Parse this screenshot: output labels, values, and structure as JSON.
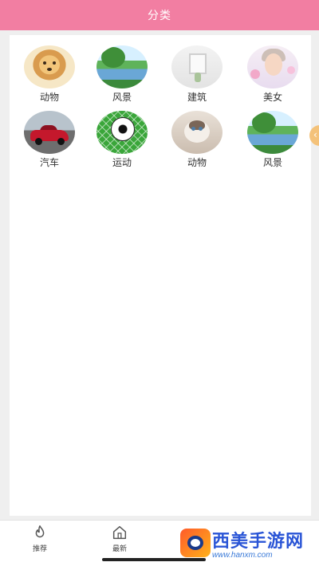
{
  "header": {
    "title": "分类"
  },
  "categories": [
    {
      "label": "动物",
      "image": "puppy"
    },
    {
      "label": "风景",
      "image": "lake-landscape"
    },
    {
      "label": "建筑",
      "image": "interior-window"
    },
    {
      "label": "美女",
      "image": "portrait"
    },
    {
      "label": "汽车",
      "image": "red-car"
    },
    {
      "label": "运动",
      "image": "soccer-ball"
    },
    {
      "label": "动物",
      "image": "cat"
    },
    {
      "label": "风景",
      "image": "lake-landscape"
    }
  ],
  "tabbar": {
    "tabs": [
      {
        "label": "推荐",
        "icon": "flame-icon"
      },
      {
        "label": "最新",
        "icon": "home-icon"
      }
    ]
  },
  "watermark": {
    "text": "西美手游网",
    "url": "www.hanxm.com"
  },
  "colors": {
    "header": "#f27ea2",
    "background": "#efefef",
    "panel": "#ffffff"
  }
}
